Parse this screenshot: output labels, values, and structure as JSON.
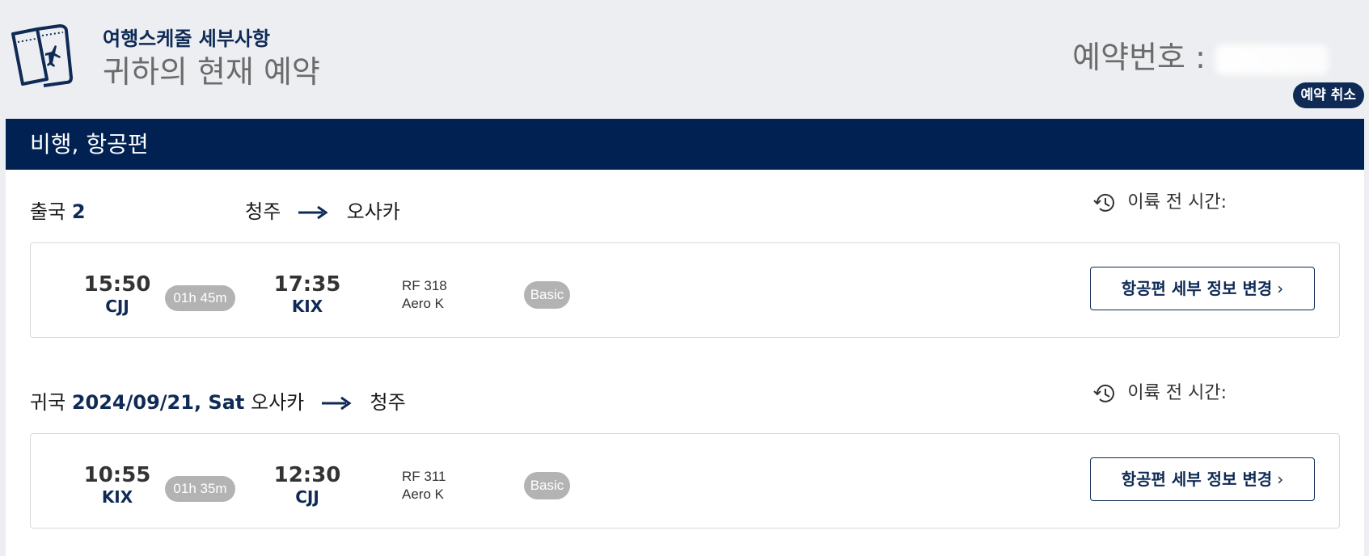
{
  "header": {
    "subtitle": "여행스케줄 세부사항",
    "title": "귀하의 현재 예약",
    "booking_label": "예약번호 :",
    "cancel_label": "예약 취소"
  },
  "section": {
    "title": "비행, 항공편"
  },
  "legs": [
    {
      "direction": "출국",
      "date": "2",
      "origin": "청주",
      "destination": "오사카",
      "time_left_label": "이륙 전 시간:",
      "flight": {
        "dep_time": "15:50",
        "dep_code": "CJJ",
        "duration": "01h 45m",
        "arr_time": "17:35",
        "arr_code": "KIX",
        "flight_no": "RF 318",
        "airline": "Aero K",
        "fare": "Basic",
        "change_label": "항공편 세부 정보 변경"
      }
    },
    {
      "direction": "귀국",
      "date": "2024/09/21, Sat",
      "origin": "오사카",
      "destination": "청주",
      "time_left_label": "이륙 전 시간:",
      "flight": {
        "dep_time": "10:55",
        "dep_code": "KIX",
        "duration": "01h 35m",
        "arr_time": "12:30",
        "arr_code": "CJJ",
        "flight_no": "RF 311",
        "airline": "Aero K",
        "fare": "Basic",
        "change_label": "항공편 세부 정보 변경"
      }
    }
  ],
  "icons": {
    "ticket": "ticket-icon",
    "arrow": "arrow-right-icon",
    "clock": "history-clock-icon",
    "chevron": "chevron-right-icon"
  },
  "colors": {
    "navy": "#002152",
    "accent": "#0e2a55",
    "pill": "#b3b3b3",
    "background": "#eceef1"
  }
}
